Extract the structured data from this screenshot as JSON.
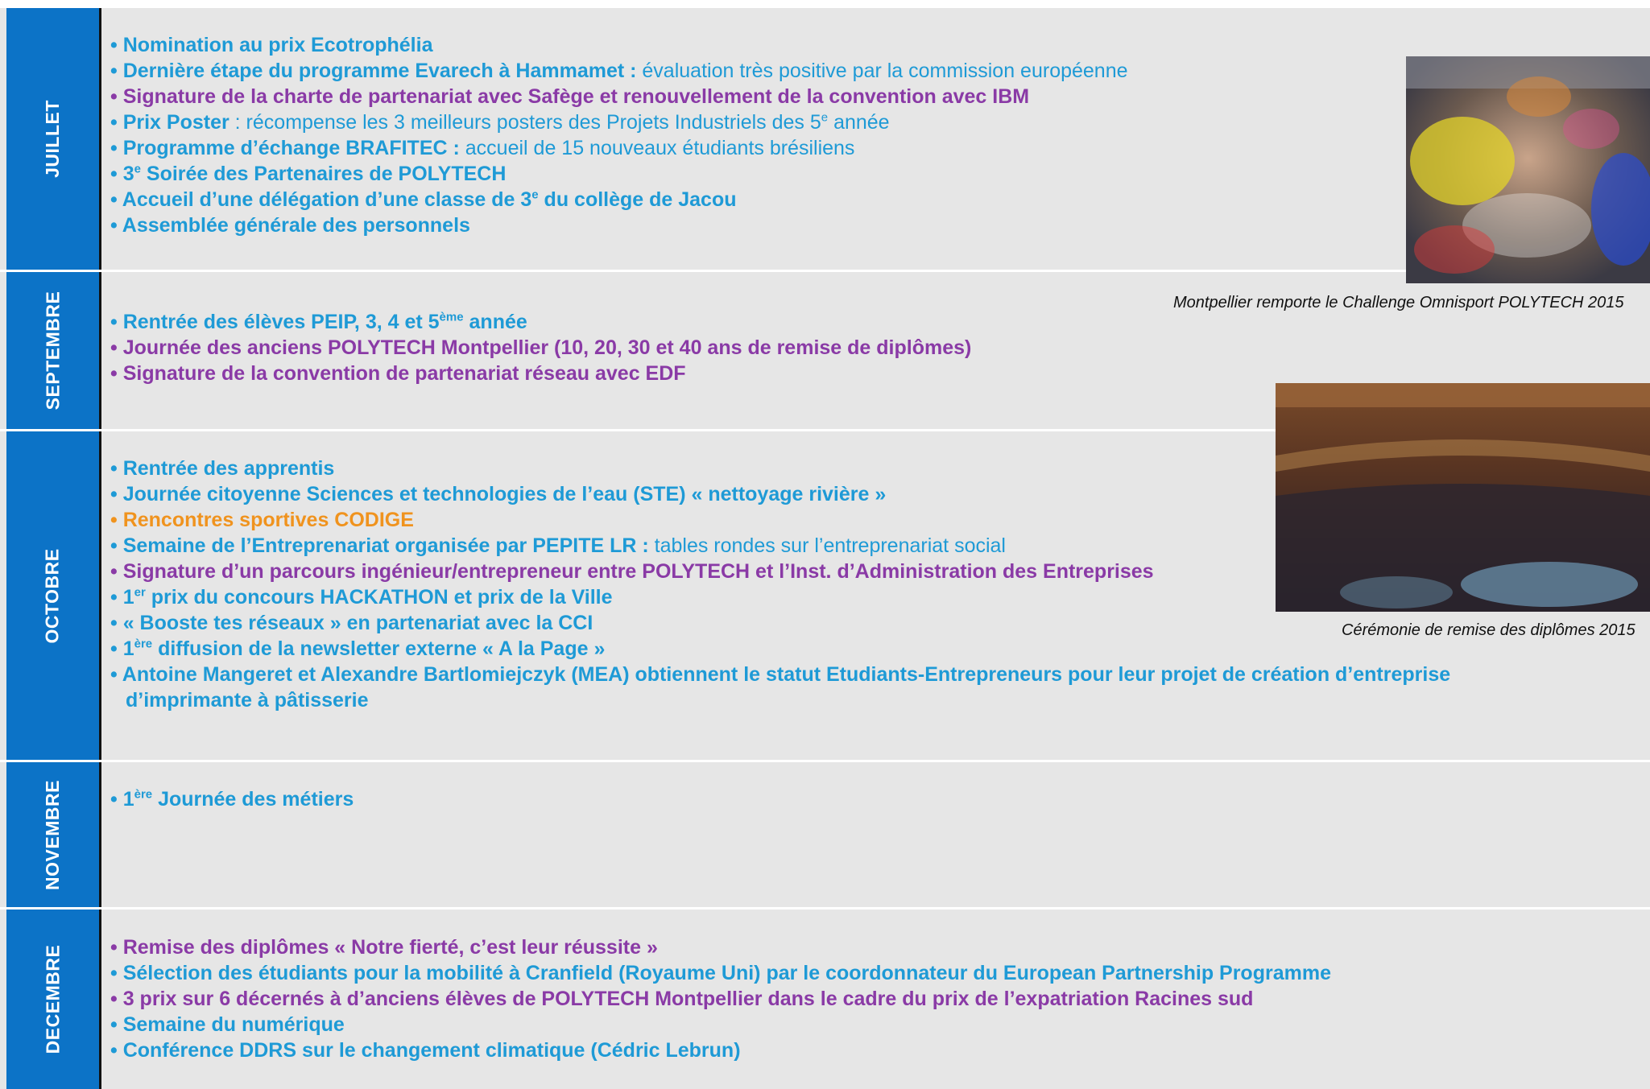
{
  "months": {
    "juillet": "JUILLET",
    "septembre": "SEPTEMBRE",
    "octobre": "OCTOBRE",
    "novembre": "NOVEMBRE",
    "decembre": "DECEMBRE"
  },
  "bullet": "• ",
  "juillet": [
    {
      "text": "Nomination au prix Ecotrophélia"
    },
    {
      "strong": "Dernière étape du programme Evarech à Hammamet : ",
      "rest": "évaluation très positive par la commission européenne"
    },
    {
      "text": "Signature de la charte de partenariat avec Safège et renouvellement de la convention avec IBM"
    },
    {
      "strong": "Prix Poster",
      "rest_a": " : récompense les 3 meilleurs posters des Projets Industriels des 5",
      "sup": "e",
      "rest_b": " année"
    },
    {
      "strong": "Programme d’échange BRAFITEC : ",
      "rest": "accueil de 15 nouveaux étudiants brésiliens"
    },
    {
      "a": "3",
      "sup": "e",
      "b": " Soirée des Partenaires de POLYTECH"
    },
    {
      "a": "Accueil d’une délégation d’une classe de 3",
      "sup": "e",
      "b": " du collège de Jacou"
    },
    {
      "text": "Assemblée générale des personnels"
    }
  ],
  "septembre": [
    {
      "a": "Rentrée des élèves PEIP, 3, 4 et 5",
      "sup": "ème",
      "b": " année"
    },
    {
      "text": "Journée des anciens POLYTECH Montpellier (10, 20, 30 et 40 ans de remise de diplômes)"
    },
    {
      "text": "Signature de la convention de partenariat réseau avec EDF"
    }
  ],
  "octobre": [
    {
      "text": "Rentrée des apprentis"
    },
    {
      "text": "Journée citoyenne Sciences et technologies de l’eau (STE) « nettoyage rivière »"
    },
    {
      "text": "Rencontres sportives CODIGE"
    },
    {
      "strong": "Semaine de l’Entreprenariat organisée par PEPITE LR : ",
      "rest": "tables rondes sur l’entreprenariat social"
    },
    {
      "text": "Signature d’un parcours ingénieur/entrepreneur entre POLYTECH et l’Inst. d’Administration des Entreprises"
    },
    {
      "a": "1",
      "sup": "er",
      "b": " prix du concours HACKATHON et prix de la Ville"
    },
    {
      "text": "« Booste tes réseaux » en partenariat avec la CCI"
    },
    {
      "a": "1",
      "sup": "ère",
      "b": " diffusion de la newsletter externe « A la Page »"
    },
    {
      "line1": "Antoine Mangeret et Alexandre Bartlomiejczyk (MEA) obtiennent le statut Etudiants-Entrepreneurs pour leur projet de création d’entreprise",
      "line2": "d’imprimante à pâtisserie"
    }
  ],
  "novembre": [
    {
      "a": "1",
      "sup": "ère",
      "b": " Journée des métiers"
    }
  ],
  "decembre": [
    {
      "text": "Remise des diplômes « Notre fierté, c’est leur réussite »"
    },
    {
      "text": "Sélection des étudiants pour la mobilité à Cranfield (Royaume Uni) par le coordonnateur du European Partnership Programme"
    },
    {
      "text": "3 prix sur 6 décernés à d’anciens élèves de POLYTECH Montpellier dans le cadre du prix de l’expatriation Racines sud"
    },
    {
      "text": "Semaine du numérique"
    },
    {
      "text": "Conférence DDRS sur le changement climatique (Cédric Lebrun)"
    }
  ],
  "captions": {
    "omnisport": "Montpellier remporte le Challenge Omnisport POLYTECH 2015",
    "ceremonie": "Cérémonie de remise des diplômes 2015"
  }
}
